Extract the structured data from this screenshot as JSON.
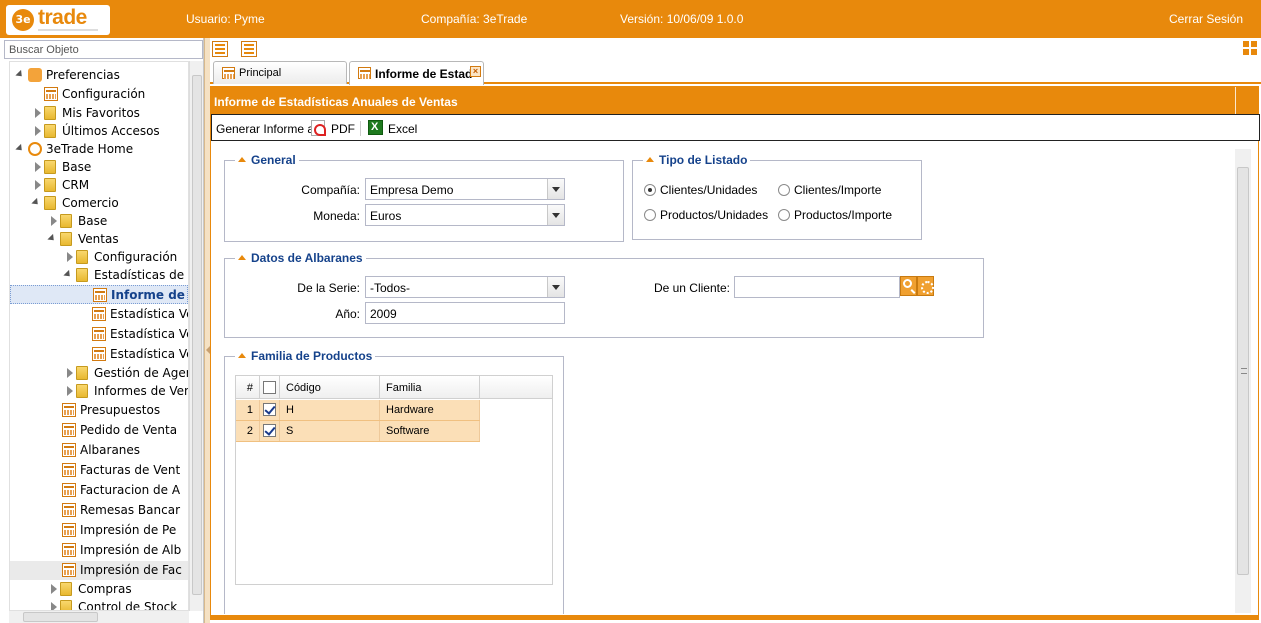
{
  "header": {
    "logo_text": "trade",
    "logo_mark": "3e",
    "usuario": "Usuario: Pyme",
    "compania": "Compañía: 3eTrade",
    "version": "Versión: 10/06/09 1.0.0",
    "logout": "Cerrar Sesión"
  },
  "sidebar": {
    "search_placeholder": "Buscar Objeto",
    "tree": [
      {
        "label": "Preferencias",
        "icon": "people-icon"
      },
      {
        "label": "Configuración",
        "icon": "report-icon"
      },
      {
        "label": "Mis Favoritos",
        "icon": "folder-icon"
      },
      {
        "label": "Últimos Accesos",
        "icon": "folder-icon"
      },
      {
        "label": "3eTrade Home",
        "icon": "home-icon"
      },
      {
        "label": "Base",
        "icon": "folder-icon"
      },
      {
        "label": "CRM",
        "icon": "folder-icon"
      },
      {
        "label": "Comercio",
        "icon": "folder-icon"
      },
      {
        "label": "Base",
        "icon": "folder-icon"
      },
      {
        "label": "Ventas",
        "icon": "folder-icon"
      },
      {
        "label": "Configuración",
        "icon": "folder-icon"
      },
      {
        "label": "Estadísticas de V",
        "icon": "folder-icon"
      },
      {
        "label": "Informe de E",
        "icon": "report-icon"
      },
      {
        "label": "Estadística Ve",
        "icon": "report-icon"
      },
      {
        "label": "Estadística Ve",
        "icon": "report-icon"
      },
      {
        "label": "Estadística Ve",
        "icon": "report-icon"
      },
      {
        "label": "Gestión de Agent",
        "icon": "folder-icon"
      },
      {
        "label": "Informes de Ven",
        "icon": "folder-icon"
      },
      {
        "label": "Presupuestos",
        "icon": "report-icon"
      },
      {
        "label": "Pedido de Venta",
        "icon": "report-icon"
      },
      {
        "label": "Albaranes",
        "icon": "report-icon"
      },
      {
        "label": "Facturas de Vent",
        "icon": "report-icon"
      },
      {
        "label": "Facturacion de A",
        "icon": "report-icon"
      },
      {
        "label": "Remesas Bancar",
        "icon": "report-icon"
      },
      {
        "label": "Impresión de Pe",
        "icon": "report-icon"
      },
      {
        "label": "Impresión de Alb",
        "icon": "report-icon"
      },
      {
        "label": "Impresión de Fac",
        "icon": "report-icon"
      },
      {
        "label": "Compras",
        "icon": "folder-icon"
      },
      {
        "label": "Control de Stock",
        "icon": "folder-icon"
      }
    ]
  },
  "tabs": [
    {
      "label": "Principal",
      "active": false
    },
    {
      "label": "Informe de Estad",
      "active": true
    }
  ],
  "panel": {
    "title": "Informe de Estadísticas Anuales de Ventas",
    "toolbar": {
      "generate_label": "Generar Informe a",
      "pdf_label": "PDF",
      "excel_label": "Excel"
    },
    "general": {
      "legend": "General",
      "compania_label": "Compañía:",
      "compania_value": "Empresa Demo",
      "moneda_label": "Moneda:",
      "moneda_value": "Euros"
    },
    "tipo_listado": {
      "legend": "Tipo de Listado",
      "options": [
        {
          "label": "Clientes/Unidades",
          "checked": true
        },
        {
          "label": "Clientes/Importe",
          "checked": false
        },
        {
          "label": "Productos/Unidades",
          "checked": false
        },
        {
          "label": "Productos/Importe",
          "checked": false
        }
      ]
    },
    "datos_albaranes": {
      "legend": "Datos de Albaranes",
      "serie_label": "De la Serie:",
      "serie_value": "-Todos-",
      "anio_label": "Año:",
      "anio_value": "2009",
      "cliente_label": "De un Cliente:",
      "cliente_value": ""
    },
    "familia": {
      "legend": "Familia de Productos",
      "columns": [
        "#",
        "Código",
        "Familia"
      ],
      "rows": [
        {
          "num": "1",
          "codigo": "H",
          "familia": "Hardware",
          "checked": true
        },
        {
          "num": "2",
          "codigo": "S",
          "familia": "Software",
          "checked": true
        }
      ]
    }
  },
  "colors": {
    "accent": "#e8890c",
    "selected_row": "#fbdfb7",
    "legend_text": "#15428b"
  }
}
